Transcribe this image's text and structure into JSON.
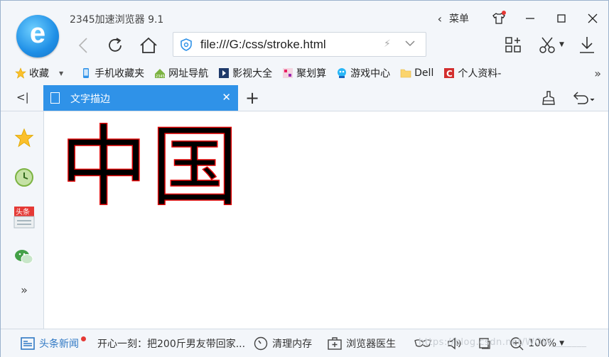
{
  "app": {
    "title": "2345加速浏览器 9.1",
    "menu_label": "菜单"
  },
  "address": {
    "url": "file:///G:/css/stroke.html"
  },
  "bookmarks": [
    {
      "label": "收藏",
      "icon": "star-icon"
    },
    {
      "label": "手机收藏夹",
      "icon": "phone-icon"
    },
    {
      "label": "网址导航",
      "icon": "2345-logo-icon"
    },
    {
      "label": "影视大全",
      "icon": "film-icon"
    },
    {
      "label": "聚划算",
      "icon": "juhuasuan-icon"
    },
    {
      "label": "游戏中心",
      "icon": "game-icon"
    },
    {
      "label": "Dell",
      "icon": "folder-icon"
    },
    {
      "label": "个人资料-",
      "icon": "c-icon"
    }
  ],
  "tab": {
    "label": "文字描边"
  },
  "page": {
    "text": "中国"
  },
  "status": {
    "news": "头条新闻",
    "headline": "开心一刻：把200斤男友带回家...",
    "clean": "清理内存",
    "doctor": "浏览器医生",
    "zoom": "100%"
  },
  "watermark": "https://blog.csdn.net/WOW_______"
}
